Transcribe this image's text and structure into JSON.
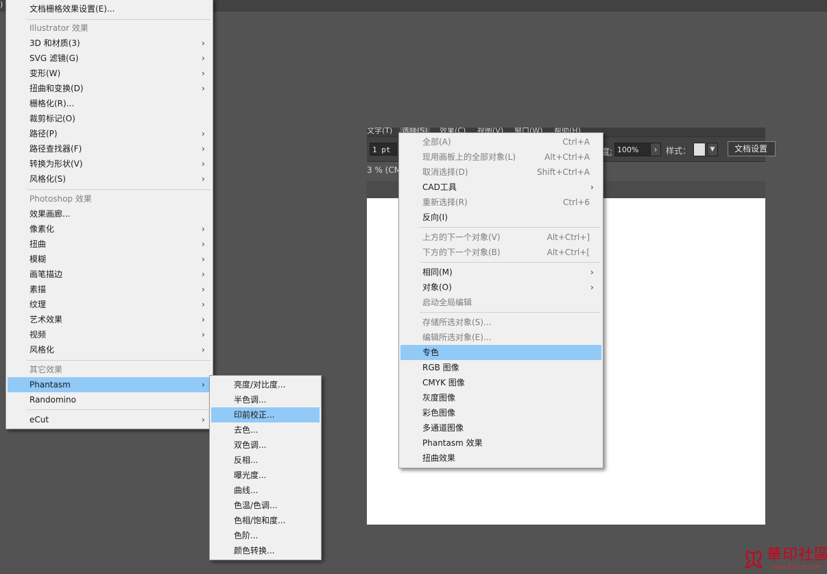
{
  "edge_glyph": ")",
  "app": {
    "menubar": [
      "文字(T)",
      "选择(S)",
      "效果(C)",
      "视图(V)",
      "窗口(W)",
      "帮助(H)"
    ],
    "stroke_value": "1 pt",
    "opacity_label": "度:",
    "opacity_value": "100%",
    "style_label": "样式：",
    "doc_setup_button": "文档设置",
    "doc_tab": "3 % (CM"
  },
  "effect_menu": {
    "top_item": "文档栅格效果设置(E)...",
    "illustrator_header": "Illustrator 效果",
    "illustrator_items": [
      {
        "label": "3D 和材质(3)",
        "sub": true
      },
      {
        "label": "SVG 滤镜(G)",
        "sub": true
      },
      {
        "label": "变形(W)",
        "sub": true
      },
      {
        "label": "扭曲和变换(D)",
        "sub": true
      },
      {
        "label": "栅格化(R)...",
        "sub": false
      },
      {
        "label": "裁剪标记(O)",
        "sub": false
      },
      {
        "label": "路径(P)",
        "sub": true
      },
      {
        "label": "路径查找器(F)",
        "sub": true
      },
      {
        "label": "转换为形状(V)",
        "sub": true
      },
      {
        "label": "风格化(S)",
        "sub": true
      }
    ],
    "photoshop_header": "Photoshop 效果",
    "photoshop_items": [
      {
        "label": "效果画廊...",
        "sub": false
      },
      {
        "label": "像素化",
        "sub": true
      },
      {
        "label": "扭曲",
        "sub": true
      },
      {
        "label": "模糊",
        "sub": true
      },
      {
        "label": "画笔描边",
        "sub": true
      },
      {
        "label": "素描",
        "sub": true
      },
      {
        "label": "纹理",
        "sub": true
      },
      {
        "label": "艺术效果",
        "sub": true
      },
      {
        "label": "视频",
        "sub": true
      },
      {
        "label": "风格化",
        "sub": true
      }
    ],
    "other_header": "其它效果",
    "other_items": [
      {
        "label": "Phantasm",
        "sub": true,
        "highlighted": true
      },
      {
        "label": "Randomino",
        "sub": false
      }
    ],
    "last_item": {
      "label": "eCut",
      "sub": true
    }
  },
  "phantasm_menu": {
    "items": [
      {
        "label": "亮度/对比度..."
      },
      {
        "label": "半色调..."
      },
      {
        "label": "印前校正...",
        "highlighted": true
      },
      {
        "label": "去色..."
      },
      {
        "label": "双色调..."
      },
      {
        "label": "反相..."
      },
      {
        "label": "曝光度..."
      },
      {
        "label": "曲线..."
      },
      {
        "label": "色温/色调..."
      },
      {
        "label": "色相/饱和度..."
      },
      {
        "label": "色阶..."
      },
      {
        "label": "颜色转换..."
      }
    ]
  },
  "select_menu": {
    "group1": [
      {
        "label": "全部(A)",
        "shortcut": "Ctrl+A",
        "disabled": true
      },
      {
        "label": "现用画板上的全部对象(L)",
        "shortcut": "Alt+Ctrl+A",
        "disabled": true
      },
      {
        "label": "取消选择(D)",
        "shortcut": "Shift+Ctrl+A",
        "disabled": true
      },
      {
        "label": "CAD工具",
        "shortcut": "",
        "sub": true
      },
      {
        "label": "重新选择(R)",
        "shortcut": "Ctrl+6",
        "disabled": true
      },
      {
        "label": "反向(I)",
        "shortcut": ""
      }
    ],
    "group2": [
      {
        "label": "上方的下一个对象(V)",
        "shortcut": "Alt+Ctrl+]",
        "disabled": true
      },
      {
        "label": "下方的下一个对象(B)",
        "shortcut": "Alt+Ctrl+[",
        "disabled": true
      }
    ],
    "group3": [
      {
        "label": "相同(M)",
        "sub": true
      },
      {
        "label": "对象(O)",
        "sub": true
      },
      {
        "label": "启动全局编辑",
        "disabled": true
      }
    ],
    "group4": [
      {
        "label": "存储所选对象(S)...",
        "disabled": true
      },
      {
        "label": "编辑所选对象(E)...",
        "disabled": true
      },
      {
        "label": "专色",
        "highlighted": true
      },
      {
        "label": "RGB 图像"
      },
      {
        "label": "CMYK 图像"
      },
      {
        "label": "灰度图像"
      },
      {
        "label": "彩色图像"
      },
      {
        "label": "多通道图像"
      },
      {
        "label": "Phantasm 效果"
      },
      {
        "label": "扭曲效果"
      }
    ]
  },
  "watermark": {
    "title": "華印社區",
    "url": "www.52cnp.com",
    "logo_icon": "butterfly-logo-icon",
    "brand_color": "#d0021b"
  },
  "colors": {
    "menu_bg": "#f0f0f0",
    "highlight": "#91c9f7",
    "workspace": "#535353"
  }
}
